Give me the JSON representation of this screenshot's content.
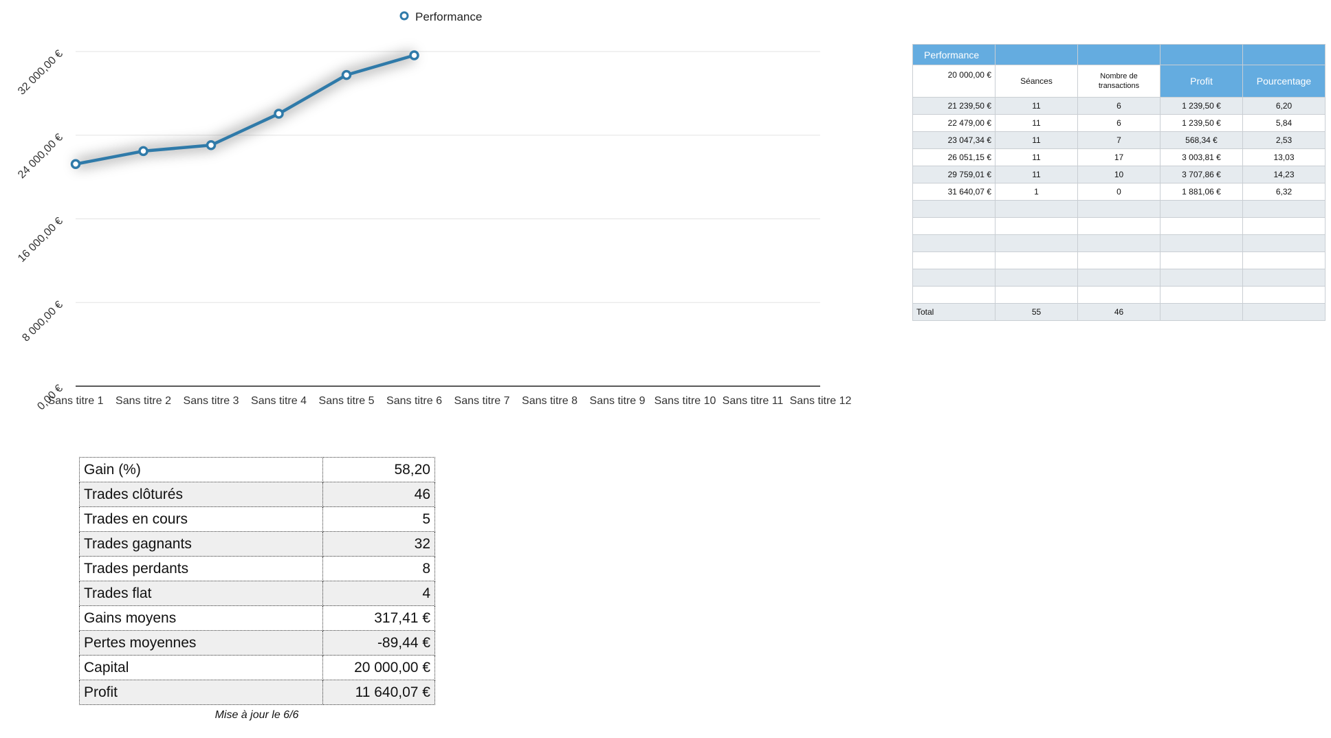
{
  "chart_data": {
    "type": "line",
    "legend": {
      "position": "top-center",
      "label": "Performance"
    },
    "categories": [
      "Sans titre 1",
      "Sans titre 2",
      "Sans titre 3",
      "Sans titre 4",
      "Sans titre 5",
      "Sans titre 6",
      "Sans titre 7",
      "Sans titre 8",
      "Sans titre 9",
      "Sans titre 10",
      "Sans titre 11",
      "Sans titre 12"
    ],
    "series": [
      {
        "name": "Performance",
        "color": "#2f7aa9",
        "values": [
          21239.5,
          22479.0,
          23047.34,
          26051.15,
          29759.01,
          31640.07
        ]
      }
    ],
    "ylim": [
      0,
      32000
    ],
    "y_ticks": [
      {
        "value": 0,
        "label": "0,00 €"
      },
      {
        "value": 8000,
        "label": "8 000,00 €"
      },
      {
        "value": 16000,
        "label": "16 000,00 €"
      },
      {
        "value": 24000,
        "label": "24 000,00 €"
      },
      {
        "value": 32000,
        "label": "32 000,00 €"
      }
    ],
    "grid": true
  },
  "perf_table": {
    "title": "Performance",
    "capital": "20 000,00 €",
    "headers": {
      "seances": "Séances",
      "nb_transactions": "Nombre de transactions",
      "profit": "Profit",
      "pourcentage": "Pourcentage"
    },
    "rows": [
      {
        "capital": "21 239,50 €",
        "seances": "11",
        "transactions": "6",
        "profit": "1 239,50 €",
        "pct": "6,20"
      },
      {
        "capital": "22 479,00 €",
        "seances": "11",
        "transactions": "6",
        "profit": "1 239,50 €",
        "pct": "5,84"
      },
      {
        "capital": "23 047,34 €",
        "seances": "11",
        "transactions": "7",
        "profit": "568,34 €",
        "pct": "2,53"
      },
      {
        "capital": "26 051,15 €",
        "seances": "11",
        "transactions": "17",
        "profit": "3 003,81 €",
        "pct": "13,03"
      },
      {
        "capital": "29 759,01 €",
        "seances": "11",
        "transactions": "10",
        "profit": "3 707,86 €",
        "pct": "14,23"
      },
      {
        "capital": "31 640,07 €",
        "seances": "1",
        "transactions": "0",
        "profit": "1 881,06 €",
        "pct": "6,32"
      },
      {
        "capital": "",
        "seances": "",
        "transactions": "",
        "profit": "",
        "pct": ""
      },
      {
        "capital": "",
        "seances": "",
        "transactions": "",
        "profit": "",
        "pct": ""
      },
      {
        "capital": "",
        "seances": "",
        "transactions": "",
        "profit": "",
        "pct": ""
      },
      {
        "capital": "",
        "seances": "",
        "transactions": "",
        "profit": "",
        "pct": ""
      },
      {
        "capital": "",
        "seances": "",
        "transactions": "",
        "profit": "",
        "pct": ""
      },
      {
        "capital": "",
        "seances": "",
        "transactions": "",
        "profit": "",
        "pct": ""
      }
    ],
    "total": {
      "label": "Total",
      "seances": "55",
      "transactions": "46"
    }
  },
  "stats": [
    {
      "label": "Gain (%)",
      "value": "58,20"
    },
    {
      "label": "Trades clôturés",
      "value": "46"
    },
    {
      "label": "Trades en cours",
      "value": "5"
    },
    {
      "label": "Trades gagnants",
      "value": "32"
    },
    {
      "label": "Trades perdants",
      "value": "8"
    },
    {
      "label": "Trades flat",
      "value": "4"
    },
    {
      "label": "Gains moyens",
      "value": "317,41 €"
    },
    {
      "label": "Pertes moyennes",
      "value": "-89,44 €"
    },
    {
      "label": "Capital",
      "value": "20 000,00 €"
    },
    {
      "label": "Profit",
      "value": "11 640,07 €"
    }
  ],
  "update_note": "Mise à jour le 6/6"
}
